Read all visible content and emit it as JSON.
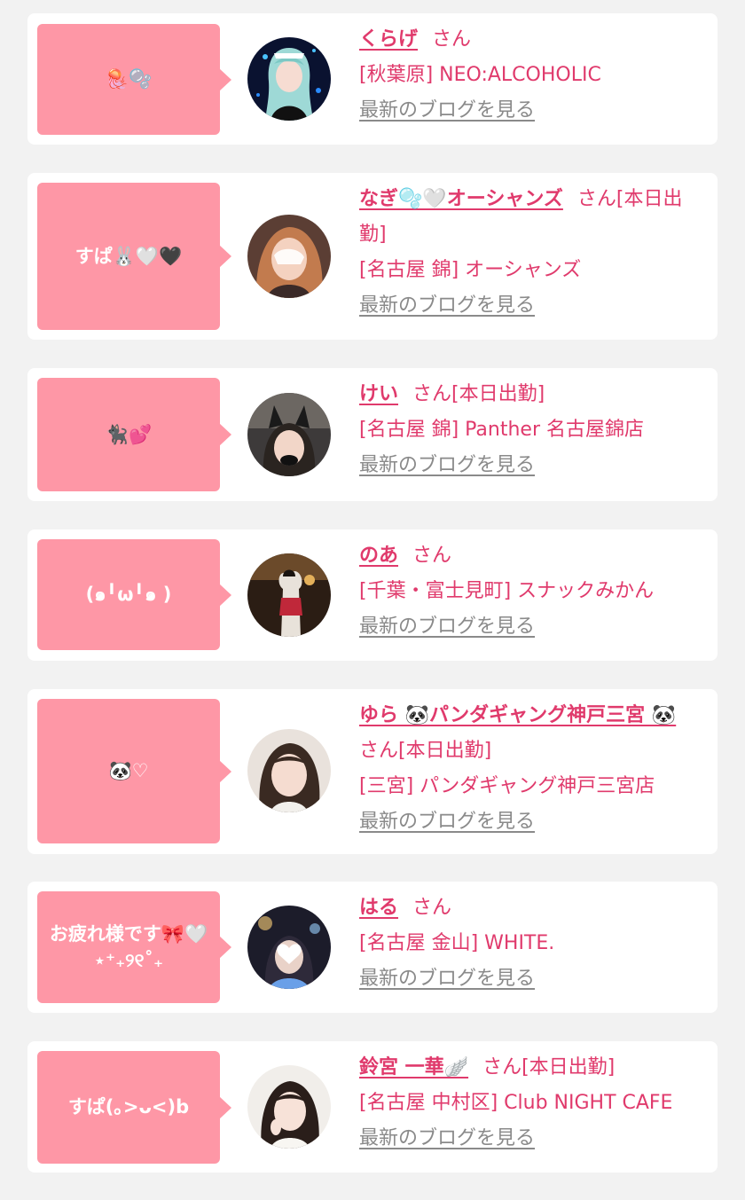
{
  "entries": [
    {
      "bubble": "🪼🫧",
      "name": "くらげ",
      "honorific": "さん",
      "status": "",
      "shop": "[秋葉原] NEO:ALCOHOLIC",
      "blog_link": "最新のブログを見る"
    },
    {
      "bubble": "すぱ🐰🤍🖤",
      "name": "なぎ🫧🤍オーシャンズ",
      "honorific": "さん",
      "status": "[本日出勤]",
      "shop": "[名古屋 錦] オーシャンズ",
      "blog_link": "最新のブログを見る"
    },
    {
      "bubble": "🐈‍⬛💕",
      "name": "けい",
      "honorific": "さん",
      "status": "[本日出勤]",
      "shop": "[名古屋 錦] Panther 名古屋錦店",
      "blog_link": "最新のブログを見る"
    },
    {
      "bubble": "(๑╹ω╹๑ )",
      "name": "のあ",
      "honorific": "さん",
      "status": "",
      "shop": "[千葉・富士見町] スナックみかん",
      "blog_link": "最新のブログを見る"
    },
    {
      "bubble": "🐼♡",
      "name": "ゆら 🐼パンダギャング神戸三宮 🐼",
      "honorific": "さん",
      "status": "[本日出勤]",
      "shop": "[三宮] パンダギャング神戸三宮店",
      "blog_link": "最新のブログを見る"
    },
    {
      "bubble": "お疲れ様です🎀🤍⋆⁺₊୨୧˚₊",
      "name": "はる",
      "honorific": "さん",
      "status": "",
      "shop": "[名古屋 金山] WHITE.",
      "blog_link": "最新のブログを見る"
    },
    {
      "bubble": "すぱ(｡>ᴗ<)b",
      "name": "鈴宮 一華🪽",
      "honorific": "さん",
      "status": "[本日出勤]",
      "shop": "[名古屋 中村区] Club NIGHT CAFE",
      "blog_link": "最新のブログを見る"
    }
  ]
}
